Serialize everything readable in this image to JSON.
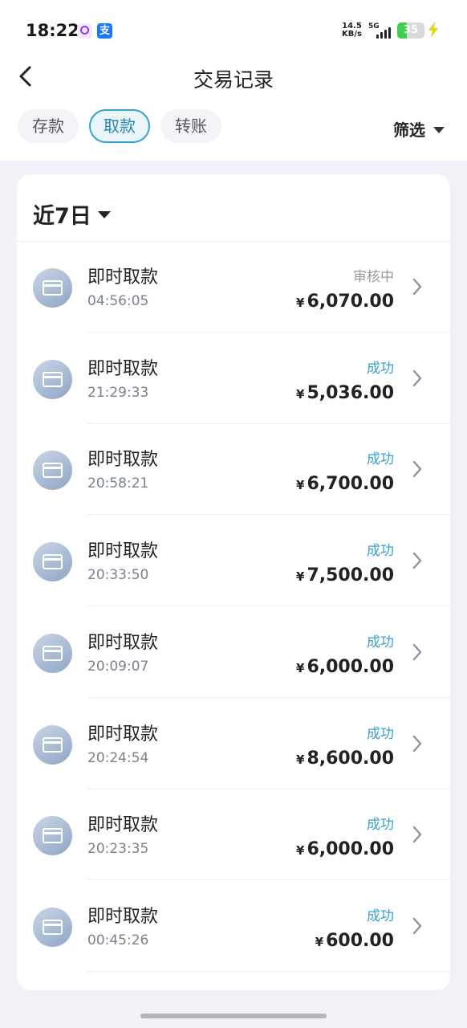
{
  "status_bar": {
    "time": "18:22",
    "net_speed_value": "14.5",
    "net_speed_unit": "KB/s",
    "network": "5G",
    "battery": "35",
    "battery_level": 0.35
  },
  "header": {
    "title": "交易记录",
    "back_icon": "chevron-left-icon"
  },
  "tabs": [
    {
      "label": "存款",
      "active": false
    },
    {
      "label": "取款",
      "active": true
    },
    {
      "label": "转账",
      "active": false
    }
  ],
  "filter": {
    "label": "筛选"
  },
  "range": {
    "label": "近7日"
  },
  "records": [
    {
      "title": "即时取款",
      "time": "04:56:05",
      "status": "审核中",
      "status_type": "pending",
      "currency": "¥",
      "amount": "6,070.00"
    },
    {
      "title": "即时取款",
      "time": "21:29:33",
      "status": "成功",
      "status_type": "ok",
      "currency": "¥",
      "amount": "5,036.00"
    },
    {
      "title": "即时取款",
      "time": "20:58:21",
      "status": "成功",
      "status_type": "ok",
      "currency": "¥",
      "amount": "6,700.00"
    },
    {
      "title": "即时取款",
      "time": "20:33:50",
      "status": "成功",
      "status_type": "ok",
      "currency": "¥",
      "amount": "7,500.00"
    },
    {
      "title": "即时取款",
      "time": "20:09:07",
      "status": "成功",
      "status_type": "ok",
      "currency": "¥",
      "amount": "6,000.00"
    },
    {
      "title": "即时取款",
      "time": "20:24:54",
      "status": "成功",
      "status_type": "ok",
      "currency": "¥",
      "amount": "8,600.00"
    },
    {
      "title": "即时取款",
      "time": "20:23:35",
      "status": "成功",
      "status_type": "ok",
      "currency": "¥",
      "amount": "6,000.00"
    },
    {
      "title": "即时取款",
      "time": "00:45:26",
      "status": "成功",
      "status_type": "ok",
      "currency": "¥",
      "amount": "600.00"
    }
  ],
  "colors": {
    "accent": "#3aa0d0",
    "pending": "#9a9a9a",
    "background": "#f0f2f7"
  }
}
